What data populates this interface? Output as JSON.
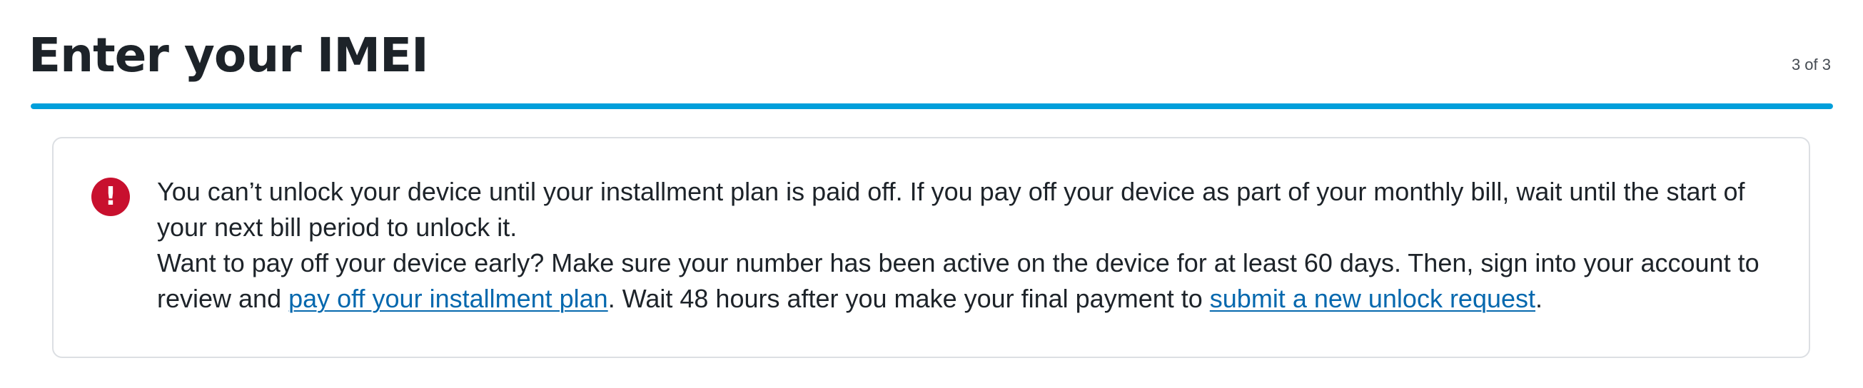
{
  "header": {
    "title": "Enter your IMEI",
    "step": "3 of 3"
  },
  "progress": {
    "fraction": 1.0,
    "fill_color": "#009fdb"
  },
  "alert": {
    "icon": "error-icon",
    "icon_color": "#c8102e",
    "line1": "You can’t unlock your device until your installment plan is paid off. If you pay off your device as part of your monthly bill, wait until the start of your next bill period to unlock it.",
    "line2_prefix": "Want to pay off your device early? Make sure your number has been active on the device for at least 60 days. Then, sign into your account to review and ",
    "link1": "pay off your installment plan",
    "line2_middle": ". Wait 48 hours after you make your final payment to ",
    "link2": "submit a new unlock request",
    "line2_suffix": "."
  }
}
